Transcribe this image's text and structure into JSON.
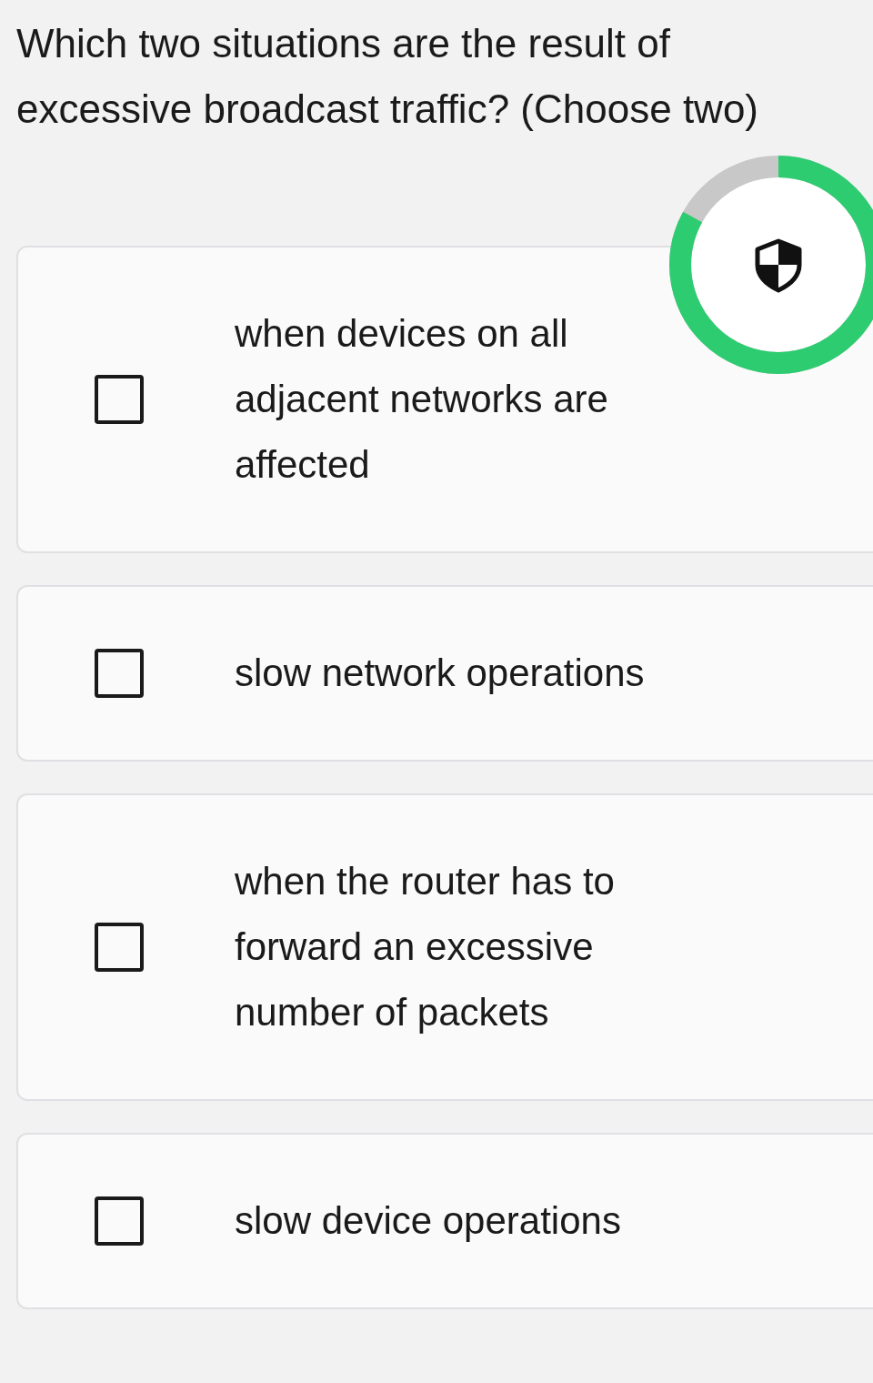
{
  "question": "Which two situations are the result of excessive broadcast traffic? (Choose two)",
  "options": [
    {
      "text": "when devices on all adjacent networks are affected",
      "checked": false
    },
    {
      "text": "slow network operations",
      "checked": false
    },
    {
      "text": "when the router has to forward an excessive number of packets",
      "checked": false
    },
    {
      "text": "slow device operations",
      "checked": false
    }
  ]
}
